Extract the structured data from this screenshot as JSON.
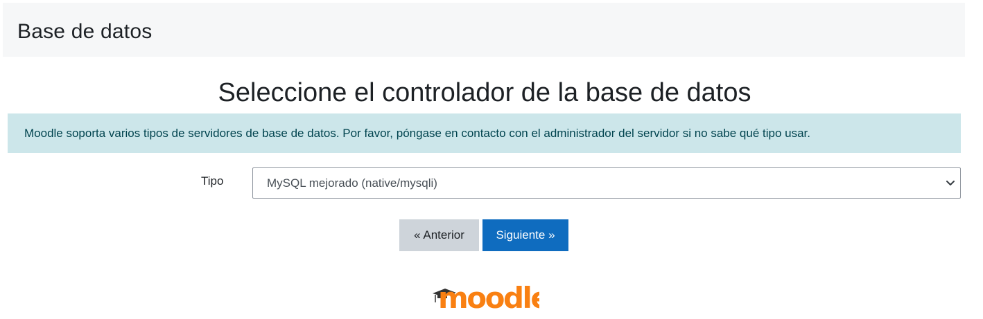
{
  "header": {
    "title": "Base de datos"
  },
  "main": {
    "title": "Seleccione el controlador de la base de datos",
    "alert_text": "Moodle soporta varios tipos de servidores de base de datos. Por favor, póngase en contacto con el administrador del servidor si no sabe qué tipo usar.",
    "type_label": "Tipo",
    "type_selected": "MySQL mejorado (native/mysqli)"
  },
  "buttons": {
    "previous_label": "« Anterior",
    "next_label": "Siguiente »"
  },
  "footer": {
    "logo_text": "moodle",
    "logo_icon": "graduation-cap-icon"
  },
  "colors": {
    "header_bg": "#f6f7f8",
    "alert_bg": "#cce6ea",
    "alert_text": "#00434e",
    "primary_button": "#0f6cbf",
    "secondary_button": "#ced4da",
    "logo_orange": "#f98012",
    "logo_cap": "#333333"
  }
}
